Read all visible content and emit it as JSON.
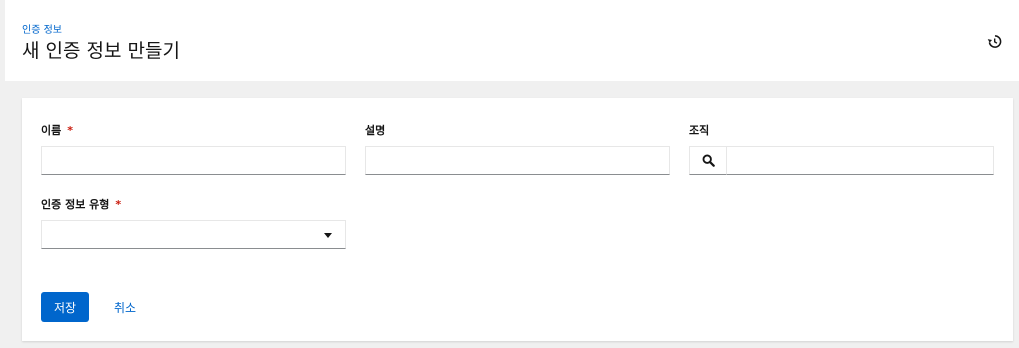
{
  "header": {
    "breadcrumb": "인증 정보",
    "title": "새 인증 정보 만들기",
    "history_icon": "history-icon"
  },
  "form": {
    "name": {
      "label": "이름",
      "required_mark": "*",
      "value": "",
      "placeholder": ""
    },
    "description": {
      "label": "설명",
      "value": "",
      "placeholder": ""
    },
    "organization": {
      "label": "조직",
      "value": "",
      "placeholder": "",
      "search_icon": "search-icon"
    },
    "credential_type": {
      "label": "인증 정보 유형",
      "required_mark": "*",
      "selected": "",
      "caret_icon": "caret-down-icon"
    }
  },
  "actions": {
    "save_label": "저장",
    "cancel_label": "취소"
  },
  "colors": {
    "primary": "#0066cc",
    "required": "#c9190b",
    "background": "#f0f0f0"
  }
}
